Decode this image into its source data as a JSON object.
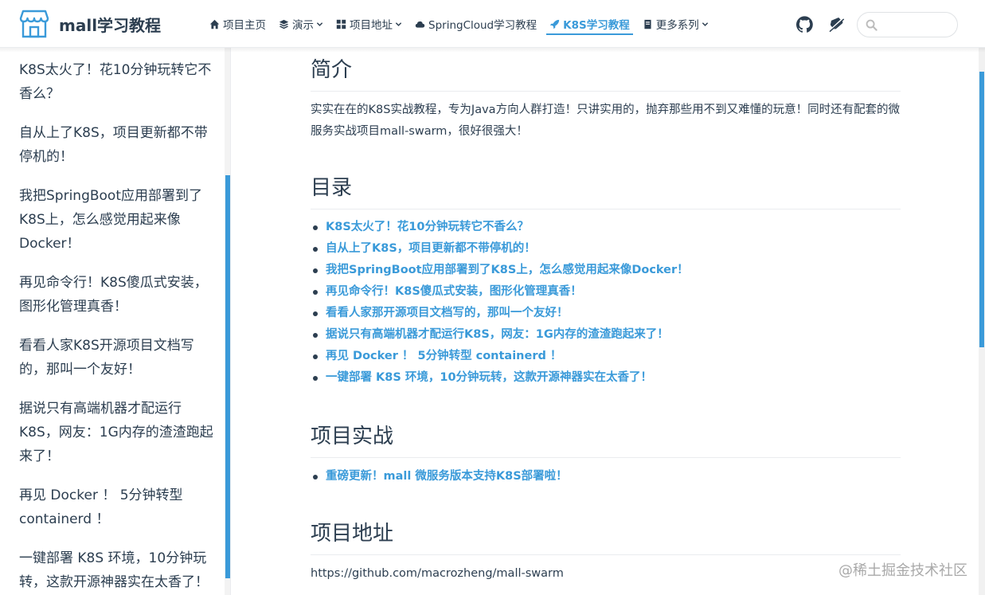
{
  "brand": {
    "title": "mall学习教程",
    "logo_icon": "store-icon"
  },
  "nav": {
    "items": [
      {
        "label": "项目主页",
        "icon": "home-icon",
        "dropdown": false,
        "active": false
      },
      {
        "label": "演示",
        "icon": "layers-icon",
        "dropdown": true,
        "active": false
      },
      {
        "label": "项目地址",
        "icon": "grid-icon",
        "dropdown": true,
        "active": false
      },
      {
        "label": "SpringCloud学习教程",
        "icon": "cloud-icon",
        "dropdown": false,
        "active": false
      },
      {
        "label": "K8S学习教程",
        "icon": "rocket-icon",
        "dropdown": false,
        "active": true
      },
      {
        "label": "更多系列",
        "icon": "book-icon",
        "dropdown": true,
        "active": false
      }
    ],
    "github_icon": "github-icon",
    "theme_icon": "theme-toggle-icon",
    "search": {
      "value": "",
      "placeholder": "",
      "icon": "search-icon"
    }
  },
  "sidebar": {
    "items": [
      "K8S太火了！花10分钟玩转它不香么？",
      "自从上了K8S，项目更新都不带停机的！",
      "我把SpringBoot应用部署到了K8S上，怎么感觉用起来像Docker！",
      "再见命令行！K8S傻瓜式安装，图形化管理真香！",
      "看看人家K8S开源项目文档写的，那叫一个友好！",
      "据说只有高端机器才配运行K8S，网友：1G内存的渣渣跑起来了！",
      "再见 Docker ！ 5分钟转型 containerd ！",
      "一键部署 K8S 环境，10分钟玩转，这款开源神器实在太香了！"
    ]
  },
  "main": {
    "intro": {
      "heading": "简介",
      "text": "实实在在的K8S实战教程，专为Java方向人群打造！只讲实用的，抛弃那些用不到又难懂的玩意！同时还有配套的微服务实战项目mall-swarm，很好很强大！"
    },
    "toc": {
      "heading": "目录",
      "links": [
        "K8S太火了！花10分钟玩转它不香么？",
        "自从上了K8S，项目更新都不带停机的！",
        "我把SpringBoot应用部署到了K8S上，怎么感觉用起来像Docker！",
        "再见命令行！K8S傻瓜式安装，图形化管理真香！",
        "看看人家那开源项目文档写的，那叫一个友好！",
        "据说只有高端机器才配运行K8S，网友：1G内存的渣渣跑起来了！",
        "再见 Docker ！ 5分钟转型 containerd ！",
        "一键部署 K8S 环境，10分钟玩转，这款开源神器实在太香了！"
      ]
    },
    "practice": {
      "heading": "项目实战",
      "links": [
        "重磅更新！mall 微服务版本支持K8S部署啦！"
      ]
    },
    "address": {
      "heading": "项目地址",
      "url": "https://github.com/macrozheng/mall-swarm"
    }
  },
  "colors": {
    "accent": "#3a9ad9",
    "text": "#2c3e50",
    "border": "#eaecef"
  },
  "watermark": "@稀土掘金技术社区"
}
